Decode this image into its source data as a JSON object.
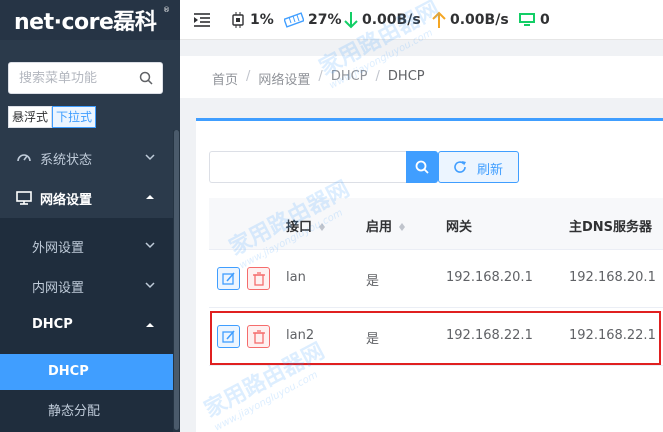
{
  "brand": {
    "logo_text": "net·core磊科",
    "reg_mark": "®"
  },
  "sidebar": {
    "search": {
      "placeholder": "搜索菜单功能"
    },
    "modes": [
      "悬浮式",
      "下拉式"
    ],
    "menu": [
      {
        "label": "系统状态",
        "icon": "gauge-icon"
      },
      {
        "label": "网络设置",
        "icon": "monitor-icon"
      },
      {
        "label": "外网设置"
      },
      {
        "label": "内网设置"
      },
      {
        "label": "DHCP"
      },
      {
        "label": "DHCP"
      },
      {
        "label": "静态分配"
      }
    ]
  },
  "topbar": {
    "cpu": "1%",
    "mem": "27%",
    "down": "0.00B/s",
    "up": "0.00B/s",
    "clients": "0"
  },
  "breadcrumb": [
    "首页",
    "网络设置",
    "DHCP",
    "DHCP"
  ],
  "toolbar": {
    "refresh_label": "刷新"
  },
  "table": {
    "columns": [
      "接口",
      "启用",
      "网关",
      "主DNS服务器"
    ],
    "rows": [
      {
        "iface": "lan",
        "enabled": "是",
        "gateway": "192.168.20.1",
        "dns": "192.168.20.1"
      },
      {
        "iface": "lan2",
        "enabled": "是",
        "gateway": "192.168.22.1",
        "dns": "192.168.22.1"
      }
    ]
  },
  "watermark": {
    "cn": "家用路由器网",
    "en": "www.jiayongluyou.com"
  },
  "colors": {
    "accent": "#409eff",
    "sidebar": "#2b3a4b",
    "highlight": "#e02020",
    "down": "#13ce66",
    "up": "#f5a623"
  }
}
